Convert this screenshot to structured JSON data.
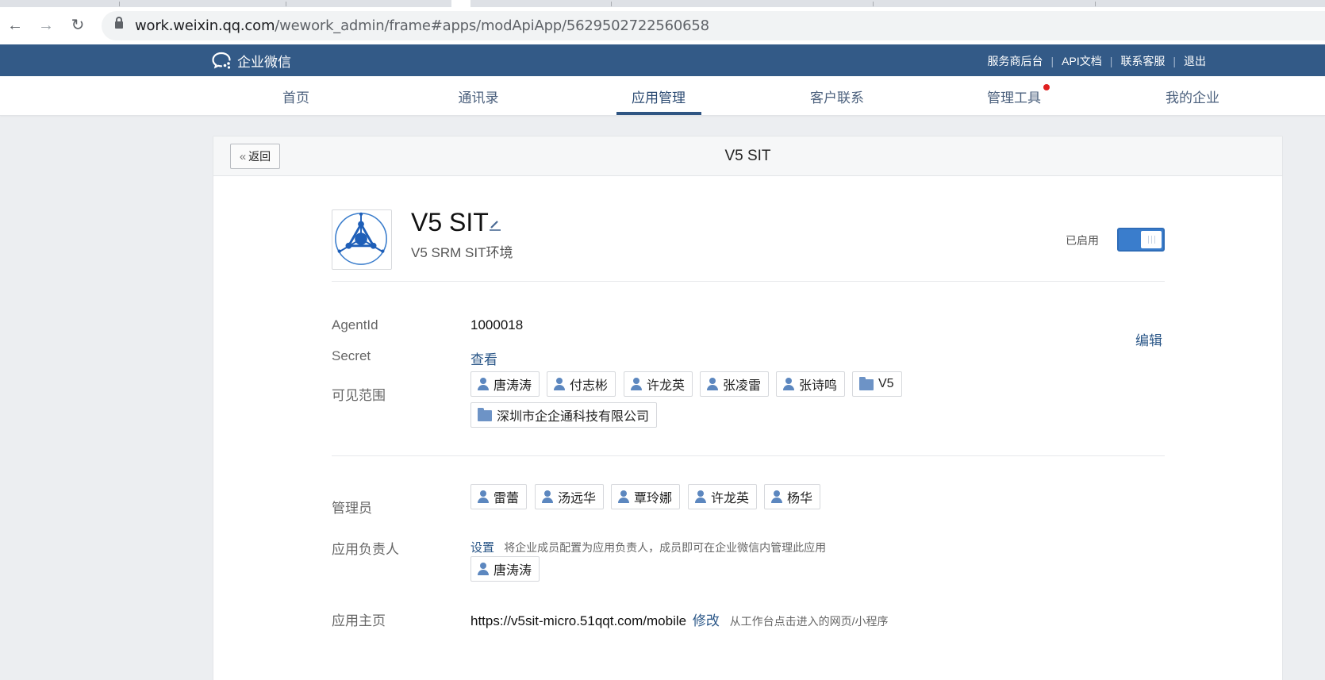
{
  "browser": {
    "url_host": "work.weixin.qq.com",
    "url_path": "/wework_admin/frame#apps/modApiApp/5629502722560658"
  },
  "header": {
    "logo_text": "企业微信",
    "links": [
      "服务商后台",
      "API文档",
      "联系客服",
      "退出"
    ],
    "separator": "|"
  },
  "nav": {
    "items": [
      "首页",
      "通讯录",
      "应用管理",
      "客户联系",
      "管理工具",
      "我的企业"
    ],
    "active": "应用管理"
  },
  "page": {
    "back_label": "返回",
    "back_chevron": "«",
    "title": "V5 SIT"
  },
  "app": {
    "name": "V5 SIT",
    "description": "V5 SRM SIT环境",
    "status_label": "已启用",
    "enabled": true,
    "icon": "app-logo-icon"
  },
  "details": {
    "agentid_label": "AgentId",
    "agentid_value": "1000018",
    "edit_label": "编辑",
    "secret_label": "Secret",
    "secret_link": "查看",
    "visible_label": "可见范围",
    "visible": [
      {
        "type": "person",
        "name": "唐涛涛"
      },
      {
        "type": "person",
        "name": "付志彬"
      },
      {
        "type": "person",
        "name": "许龙英"
      },
      {
        "type": "person",
        "name": "张凌雷"
      },
      {
        "type": "person",
        "name": "张诗鸣"
      },
      {
        "type": "folder",
        "name": "V5"
      },
      {
        "type": "folder",
        "name": "深圳市企企通科技有限公司"
      }
    ],
    "admins_label": "管理员",
    "admins": [
      "雷蕾",
      "汤远华",
      "覃玲娜",
      "许龙英",
      "杨华"
    ],
    "owner_label": "应用负责人",
    "owner_set_link": "设置",
    "owner_hint": "将企业成员配置为应用负责人，成员即可在企业微信内管理此应用",
    "owners": [
      "唐涛涛"
    ],
    "home_label": "应用主页",
    "home_url": "https://v5sit-micro.51qqt.com/mobile",
    "home_edit_link": "修改",
    "home_hint": "从工作台点击进入的网页/小程序"
  },
  "colors": {
    "topbar": "#335a87",
    "accent": "#3a7dcc",
    "link": "#2b5788",
    "notification_dot": "#e02020"
  }
}
